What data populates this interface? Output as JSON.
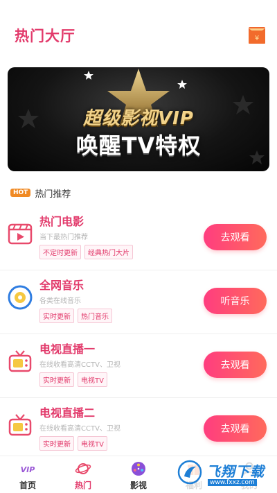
{
  "header": {
    "title": "热门大厅",
    "gift_icon": "red-envelope-icon",
    "accent": "#e23a6b"
  },
  "banner": {
    "line1": "超级影视VIP",
    "line2": "唤醒TV特权"
  },
  "section": {
    "badge": "HOT",
    "title": "热门推荐"
  },
  "cards": [
    {
      "title": "热门电影",
      "subtitle": "当下最热门推荐",
      "tags": [
        "不定时更新",
        "经典热门大片"
      ],
      "button": "去观看",
      "icon": "film-clapper-icon"
    },
    {
      "title": "全网音乐",
      "subtitle": "各类在线音乐",
      "tags": [
        "实时更新",
        "热门音乐"
      ],
      "button": "听音乐",
      "icon": "music-disc-icon"
    },
    {
      "title": "电视直播一",
      "subtitle": "在线收看高清CCTV、卫视",
      "tags": [
        "实时更新",
        "电视TV"
      ],
      "button": "去观看",
      "icon": "tv-icon"
    },
    {
      "title": "电视直播二",
      "subtitle": "在线收看高清CCTV、卫视",
      "tags": [
        "实时更新",
        "电视TV"
      ],
      "button": "去观看",
      "icon": "tv-icon"
    }
  ],
  "nav": [
    {
      "label": "首页",
      "icon": "vip-icon"
    },
    {
      "label": "热门",
      "icon": "planet-icon"
    },
    {
      "label": "影视",
      "icon": "film-reel-icon"
    },
    {
      "label": "福利",
      "icon": "gift-icon"
    },
    {
      "label": "我的",
      "icon": "user-icon"
    }
  ],
  "watermark": {
    "name": "飞翔下载",
    "url": "www.fxxz.com"
  },
  "colors": {
    "button_start": "#ff3d7f",
    "button_end": "#ff6a5c",
    "hot_badge": "#f08a24"
  }
}
